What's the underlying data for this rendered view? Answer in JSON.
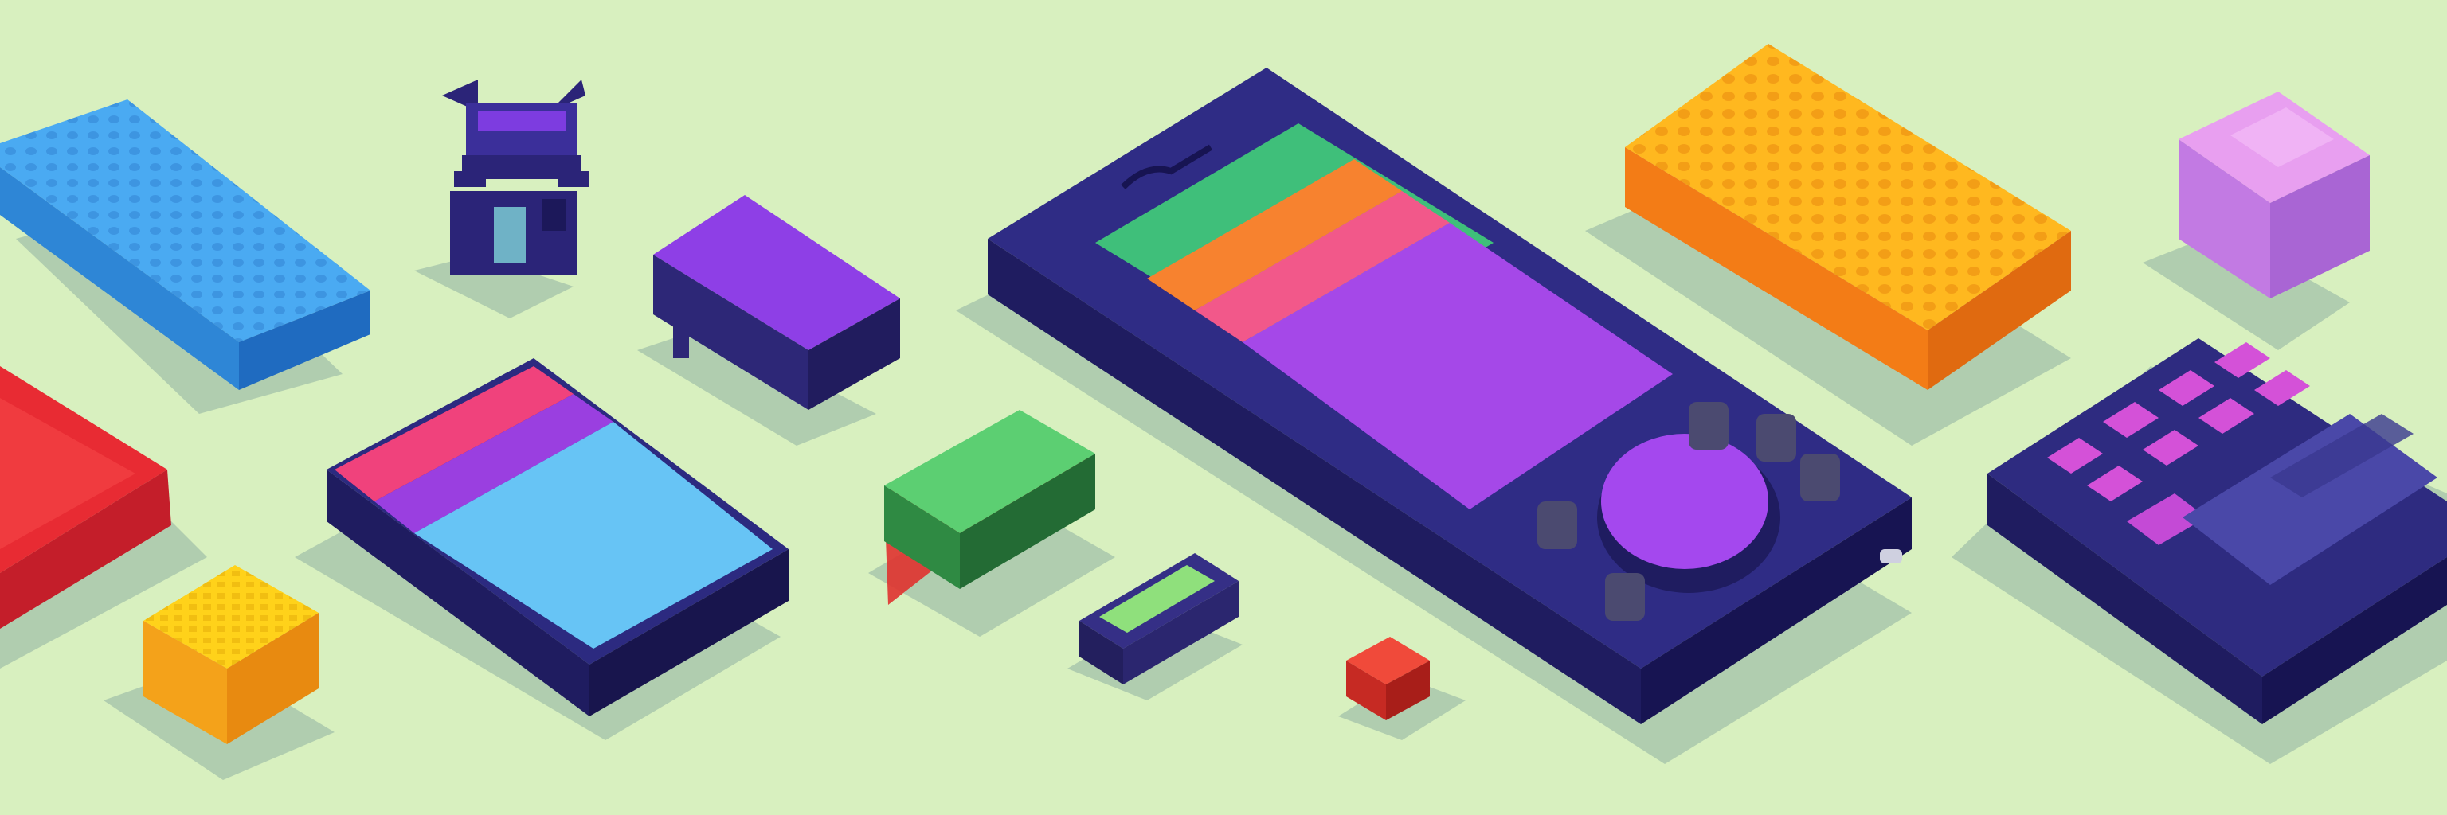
{
  "scene": {
    "background": "#d8f0bf",
    "shadow_color": "#8fb0a2",
    "objects": [
      {
        "name": "blue-sponge-block",
        "colors": {
          "top": "#4aaaf2",
          "side": "#2e86d6",
          "dots": "#3f93e0"
        }
      },
      {
        "name": "red-tray",
        "colors": {
          "top": "#e82b33",
          "side": "#c41e2a"
        }
      },
      {
        "name": "navy-robot-figure",
        "colors": {
          "body": "#2b2478",
          "accent": "#7d3ce0",
          "face": "#6fb2c6"
        }
      },
      {
        "name": "yellow-waffle-cube",
        "colors": {
          "top": "#ffd21a",
          "side": "#f4a21a"
        }
      },
      {
        "name": "purple-device",
        "colors": {
          "top": "#8e3fe6",
          "side": "#2d2777"
        }
      },
      {
        "name": "color-panel-device",
        "colors": {
          "body": "#2c2a80",
          "stripes": [
            "#f0427c",
            "#9a3fe0",
            "#67c4f5"
          ]
        }
      },
      {
        "name": "green-block",
        "colors": {
          "top": "#5ccf72",
          "side": "#2f8a43",
          "base": "#e0322f"
        }
      },
      {
        "name": "small-battery",
        "colors": {
          "body": "#352f86",
          "label": "#8fe07c"
        }
      },
      {
        "name": "red-small-cube",
        "colors": {
          "top": "#f04a3a",
          "side": "#c62a23"
        }
      },
      {
        "name": "handheld-console",
        "colors": {
          "body": "#2f2c85",
          "screen": [
            "#3fbf7a",
            "#f7822f",
            "#f2588a",
            "#a548e8"
          ],
          "dial": "#a448ee"
        }
      },
      {
        "name": "orange-waffle-block",
        "colors": {
          "top": "#ffb81f",
          "side": "#f37c16"
        }
      },
      {
        "name": "pink-cube",
        "colors": {
          "top": "#e89ff0",
          "side": "#c27ae3"
        }
      },
      {
        "name": "keypad-device",
        "colors": {
          "body": "#2e2b80",
          "keys": "#d451d8",
          "pad": "#4a48a8"
        }
      }
    ]
  }
}
